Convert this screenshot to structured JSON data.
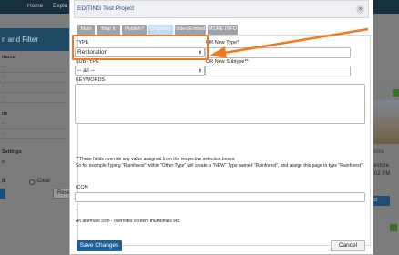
{
  "background": {
    "nav": [
      "Home",
      "Explo"
    ],
    "filter_title": "n and Filter",
    "left_labels": [
      "ource",
      "ne",
      "Settings",
      "e"
    ],
    "option_left": "It",
    "option_clear": "Clear",
    "reset_label": "Rese",
    "right_link": "Restora",
    "right_restore": "Restore",
    "right_time": "3:02 PM",
    "right_button": "ect"
  },
  "modal": {
    "title": "EDITING Test Project",
    "tabs": [
      "Main",
      "Map It",
      "Publish?",
      "Organize",
      "Video/Embed",
      "MORE INFO"
    ],
    "active_tab": "Organize",
    "type_label": "TYPE",
    "type_value": "Restoration",
    "new_type_label": "OR New Type*",
    "subtype_label": "SUBTYPE",
    "subtype_value": "-- all --",
    "new_subtype_label": "OR New Subtype**",
    "keywords_label": "KEYWORDS",
    "note_line1": "**These fields override any value assigned from the respective selection boxes.",
    "note_line2": "So for example Typing \"Rainforest\" within \"Other Type\" will create a \"NEW\" Type named \"Rainforest\", and assign this page to type \"Rainforest\".",
    "icon_label": "ICON",
    "icon_help": "An alternate icon - overrides content thumbnails etc.",
    "save_label": "Save Changes",
    "cancel_label": "Cancel"
  },
  "annotation": {
    "highlight_color": "#f07a21"
  }
}
